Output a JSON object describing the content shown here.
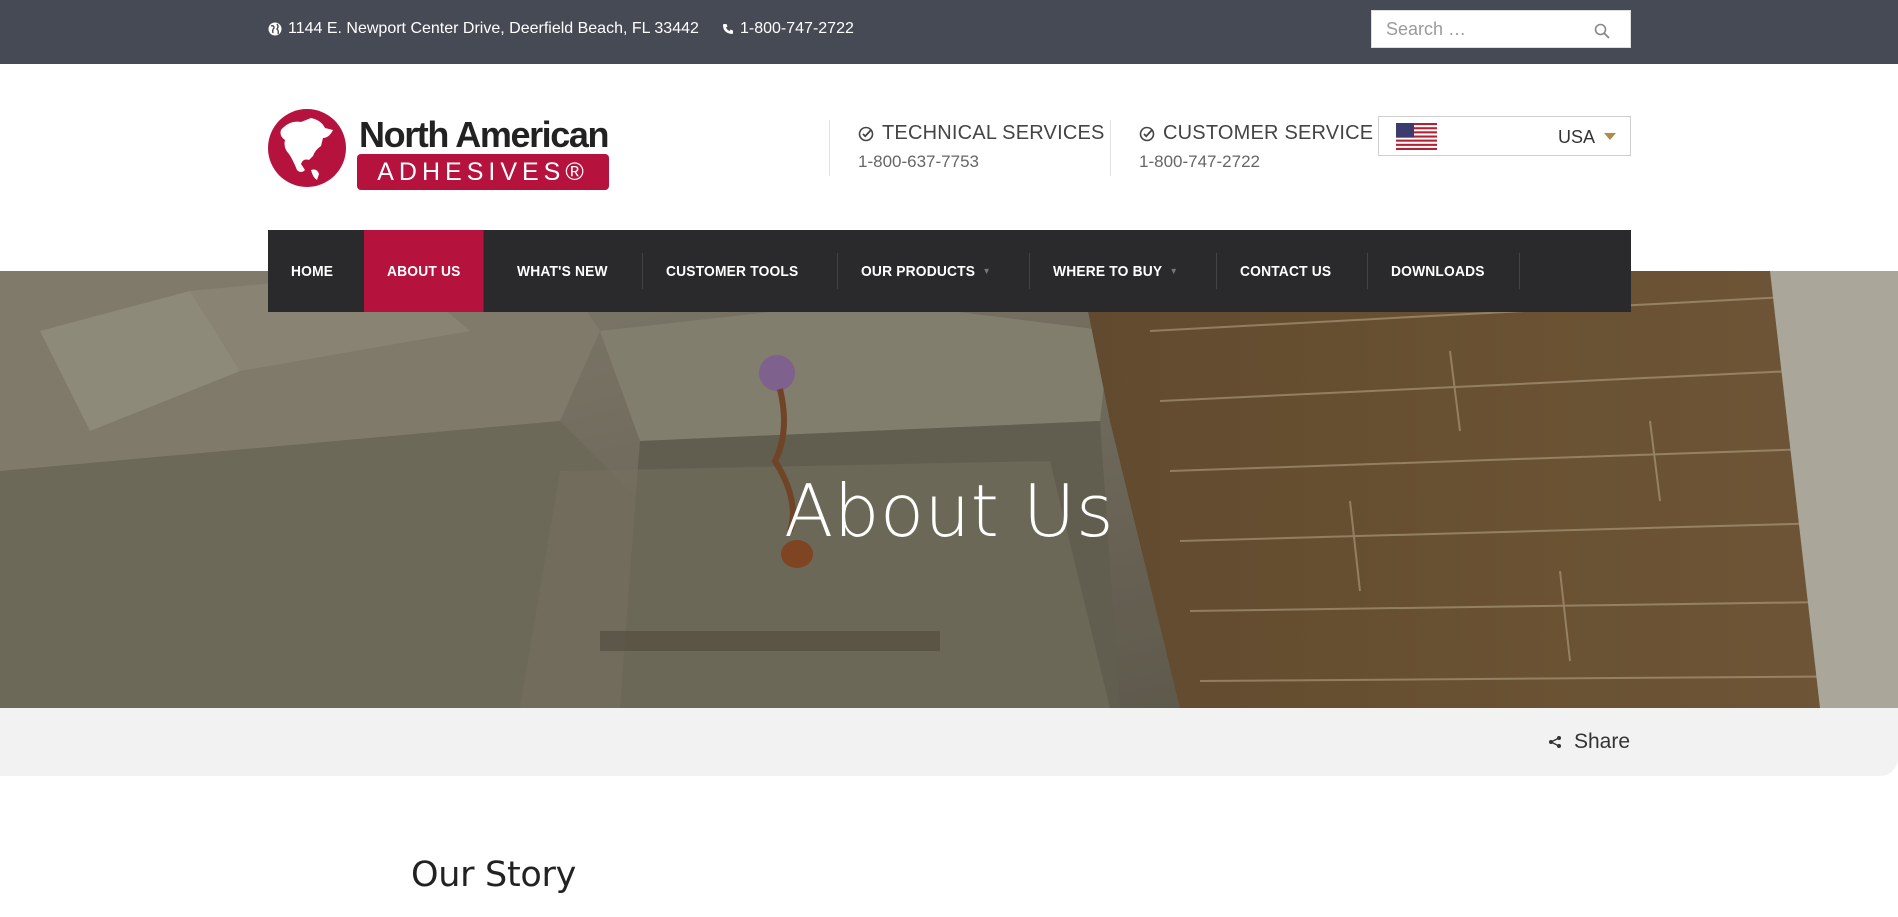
{
  "topbar": {
    "address": "1144 E. Newport Center Drive, Deerfield Beach, FL 33442",
    "phone": "1-800-747-2722",
    "search_placeholder": "Search …"
  },
  "logo": {
    "line1": "North American",
    "line2": "ADHESIVES®"
  },
  "contacts": [
    {
      "title": "TECHNICAL SERVICES",
      "number": "1-800-637-7753"
    },
    {
      "title": "CUSTOMER SERVICE",
      "number": "1-800-747-2722"
    }
  ],
  "country": {
    "selected": "USA",
    "flag_icon": "us-flag-icon"
  },
  "nav": {
    "items": [
      {
        "label": "HOME"
      },
      {
        "label": "ABOUT US",
        "active": true
      },
      {
        "label": "WHAT'S NEW"
      },
      {
        "label": "CUSTOMER TOOLS"
      },
      {
        "label": "OUR PRODUCTS",
        "dropdown": true
      },
      {
        "label": "WHERE TO BUY",
        "dropdown": true
      },
      {
        "label": "CONTACT US"
      },
      {
        "label": "DOWNLOADS"
      }
    ]
  },
  "hero": {
    "title": "About Us"
  },
  "share": {
    "label": "Share"
  },
  "content": {
    "heading": "Our Story"
  },
  "colors": {
    "topbar": "#464a55",
    "brand_red": "#b5123e",
    "nav_bg": "#2a2a2c"
  }
}
